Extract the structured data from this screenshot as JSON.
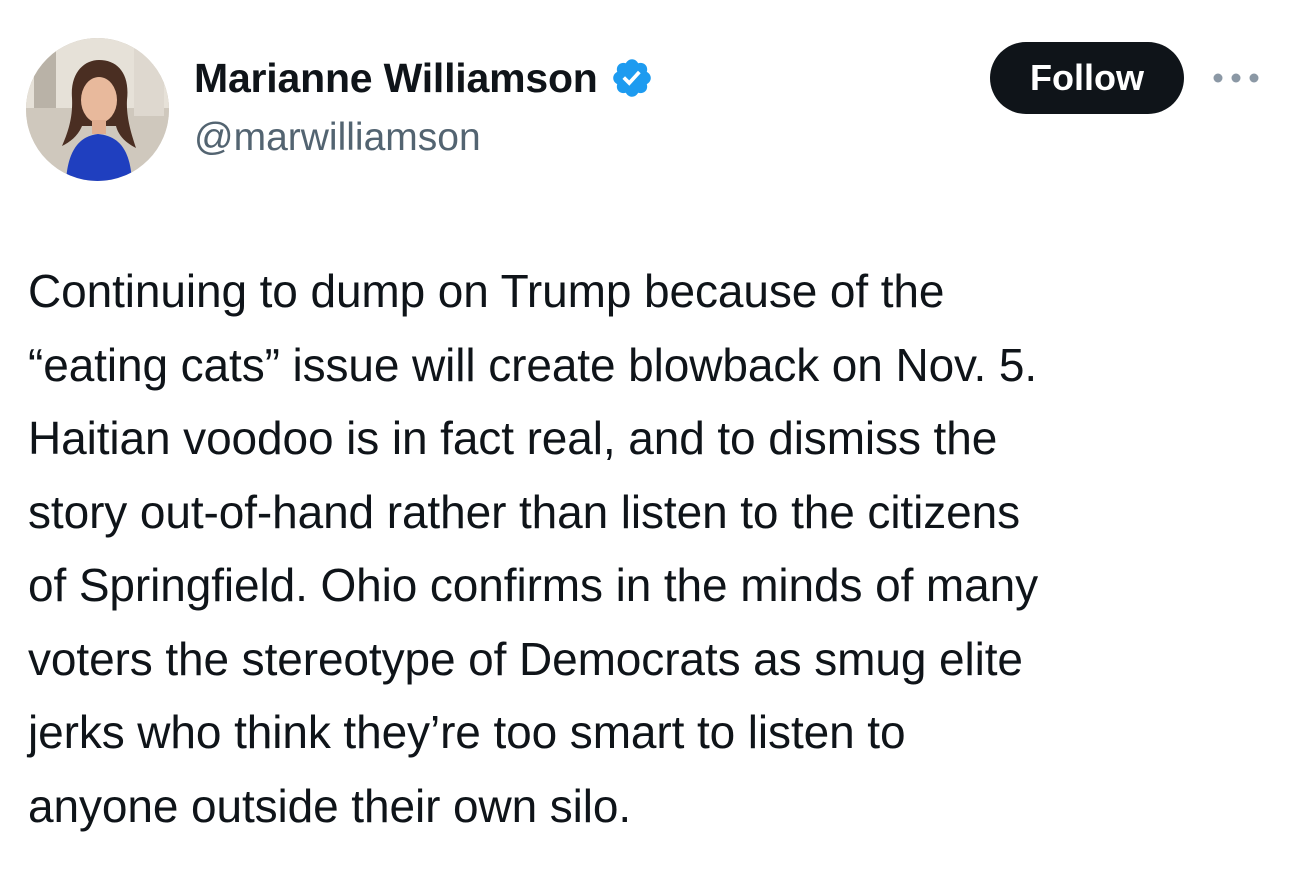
{
  "author": {
    "display_name": "Marianne Williamson",
    "handle": "@marwilliamson",
    "verified": true,
    "avatar_icon": "profile-photo"
  },
  "actions": {
    "follow_label": "Follow",
    "more_icon": "more-horizontal-icon"
  },
  "tweet": {
    "text": "Continuing to dump on Trump because of the\n“eating cats” issue will create blowback on Nov. 5.\nHaitian voodoo is in fact real, and to dismiss the\nstory out-of-hand rather than listen to the citizens\nof Springfield. Ohio confirms in the minds of many\nvoters the stereotype of Democrats as smug elite\njerks who think they’re too smart to listen to\nanyone outside their own silo."
  },
  "colors": {
    "text_primary": "#0f1419",
    "text_secondary": "#536471",
    "verified_badge": "#1d9bf0",
    "follow_button_bg": "#0f1419",
    "follow_button_text": "#ffffff"
  }
}
